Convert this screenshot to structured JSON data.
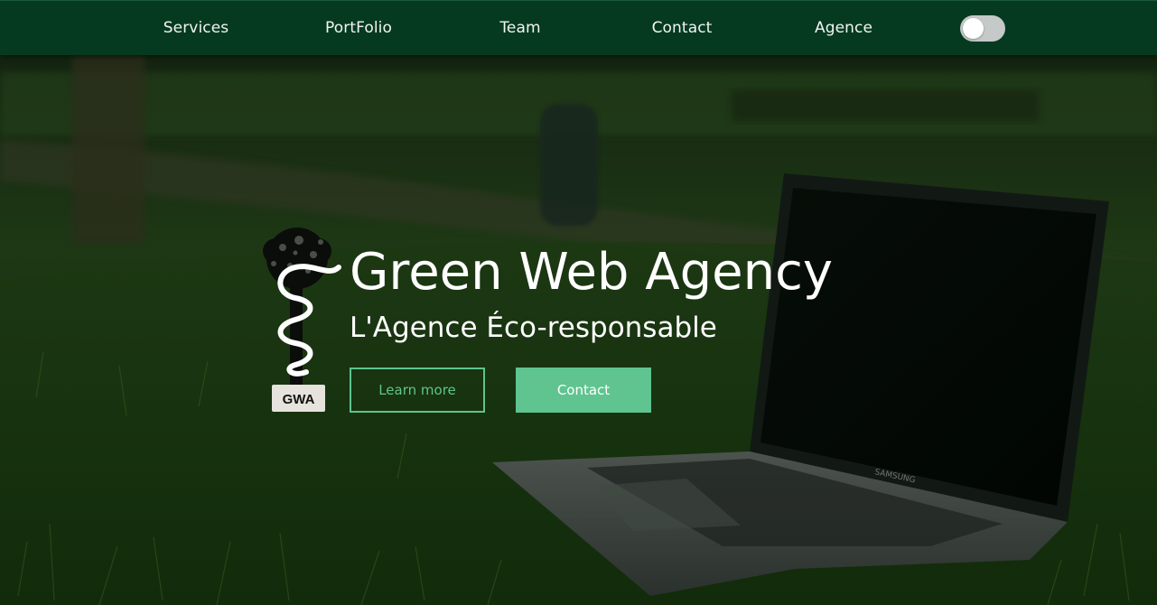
{
  "nav": {
    "items": [
      {
        "label": "Services"
      },
      {
        "label": "PortFolio"
      },
      {
        "label": "Team"
      },
      {
        "label": "Contact"
      },
      {
        "label": "Agence"
      }
    ],
    "theme_toggle": {
      "state": "off"
    }
  },
  "hero": {
    "title": "Green Web Agency",
    "subtitle": "L'Agence Éco-responsable",
    "logo_text": "GWA",
    "buttons": {
      "learn_more": "Learn more",
      "contact": "Contact"
    },
    "laptop_brand": "SAMSUNG"
  },
  "colors": {
    "nav_bg": "#053a21",
    "accent": "#5fc48f",
    "text": "#ffffff"
  }
}
